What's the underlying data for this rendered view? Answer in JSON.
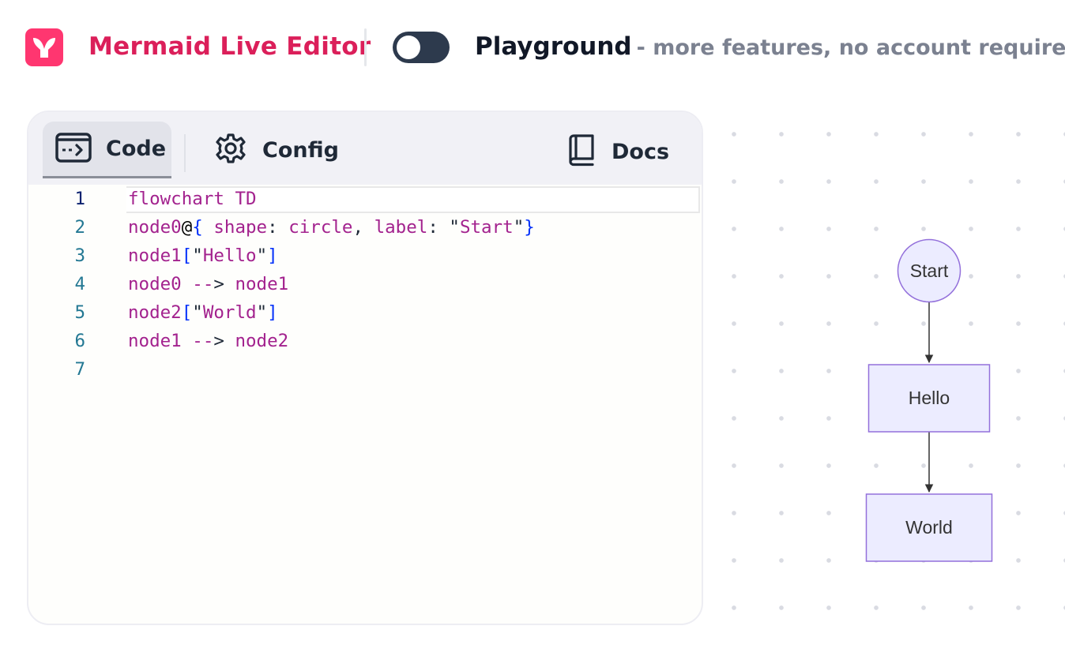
{
  "header": {
    "app_title": "Mermaid Live Editor",
    "toggle_state": "off",
    "playground_title": "Playground",
    "playground_subtitle": "- more features, no account required"
  },
  "tabs": [
    {
      "label": "Code",
      "icon": "code-arrow-icon",
      "active": true
    },
    {
      "label": "Config",
      "icon": "gear-icon",
      "active": false
    },
    {
      "label": "Docs",
      "icon": "book-icon",
      "active": false
    }
  ],
  "editor": {
    "line_numbers": [
      "1",
      "2",
      "3",
      "4",
      "5",
      "6",
      "7"
    ],
    "lines": [
      "flowchart TD",
      "node0@{ shape: circle, label: \"Start\"}",
      "node1[\"Hello\"]",
      "node0 --> node1",
      "node2[\"World\"]",
      "node1 --> node2",
      ""
    ],
    "active_line": 1
  },
  "diagram": {
    "nodes": [
      {
        "id": "node0",
        "label": "Start",
        "shape": "circle"
      },
      {
        "id": "node1",
        "label": "Hello",
        "shape": "rect"
      },
      {
        "id": "node2",
        "label": "World",
        "shape": "rect"
      }
    ],
    "edges": [
      {
        "from": "node0",
        "to": "node1"
      },
      {
        "from": "node1",
        "to": "node2"
      }
    ],
    "colors": {
      "node_fill": "#ececff",
      "node_stroke": "#9370db",
      "edge": "#333333"
    }
  },
  "colors": {
    "brand": "#ff3670",
    "title": "#db1f5a",
    "toggle": "#2d3a4d"
  }
}
